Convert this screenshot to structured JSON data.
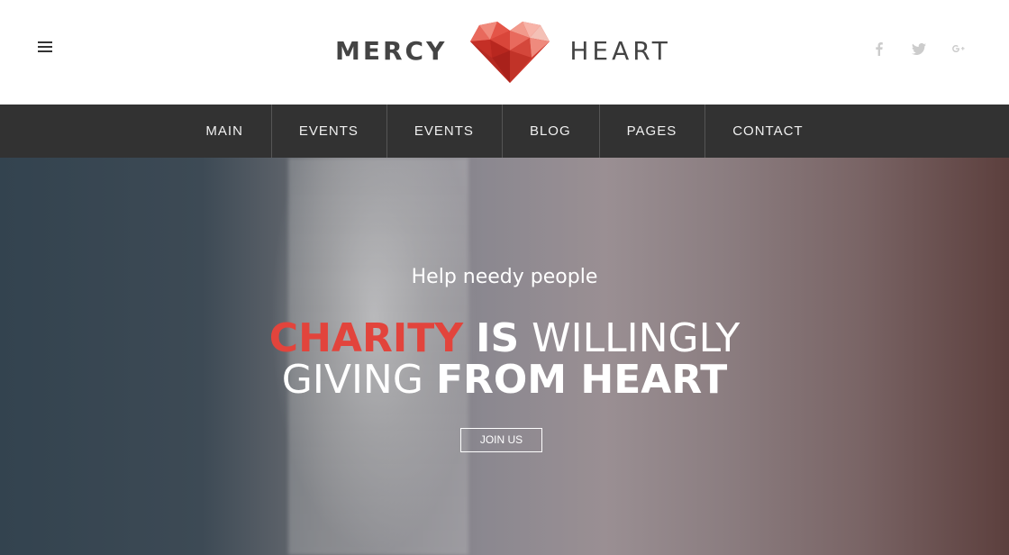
{
  "header": {
    "brand_left": "MERCY",
    "brand_right": "HEART",
    "menu_icon": "hamburger-icon",
    "socials": [
      {
        "name": "facebook-icon",
        "glyph": "f"
      },
      {
        "name": "twitter-icon",
        "glyph": "t"
      },
      {
        "name": "google-plus-icon",
        "glyph": "G+"
      }
    ]
  },
  "nav": {
    "items": [
      {
        "label": "MAIN"
      },
      {
        "label": "EVENTS"
      },
      {
        "label": "EVENTS"
      },
      {
        "label": "BLOG"
      },
      {
        "label": "PAGES"
      },
      {
        "label": "CONTACT"
      }
    ]
  },
  "hero": {
    "subtitle": "Help needy people",
    "line1_accent": "CHARITY",
    "line1_bold": "IS",
    "line1_light": "WILLINGLY",
    "line2_light": "GIVING",
    "line2_bold": "FROM HEART",
    "button_label": "JOIN US"
  },
  "colors": {
    "accent": "#e2443c",
    "navbar": "#323232",
    "brand_text": "#444444",
    "social": "#cccccc"
  }
}
